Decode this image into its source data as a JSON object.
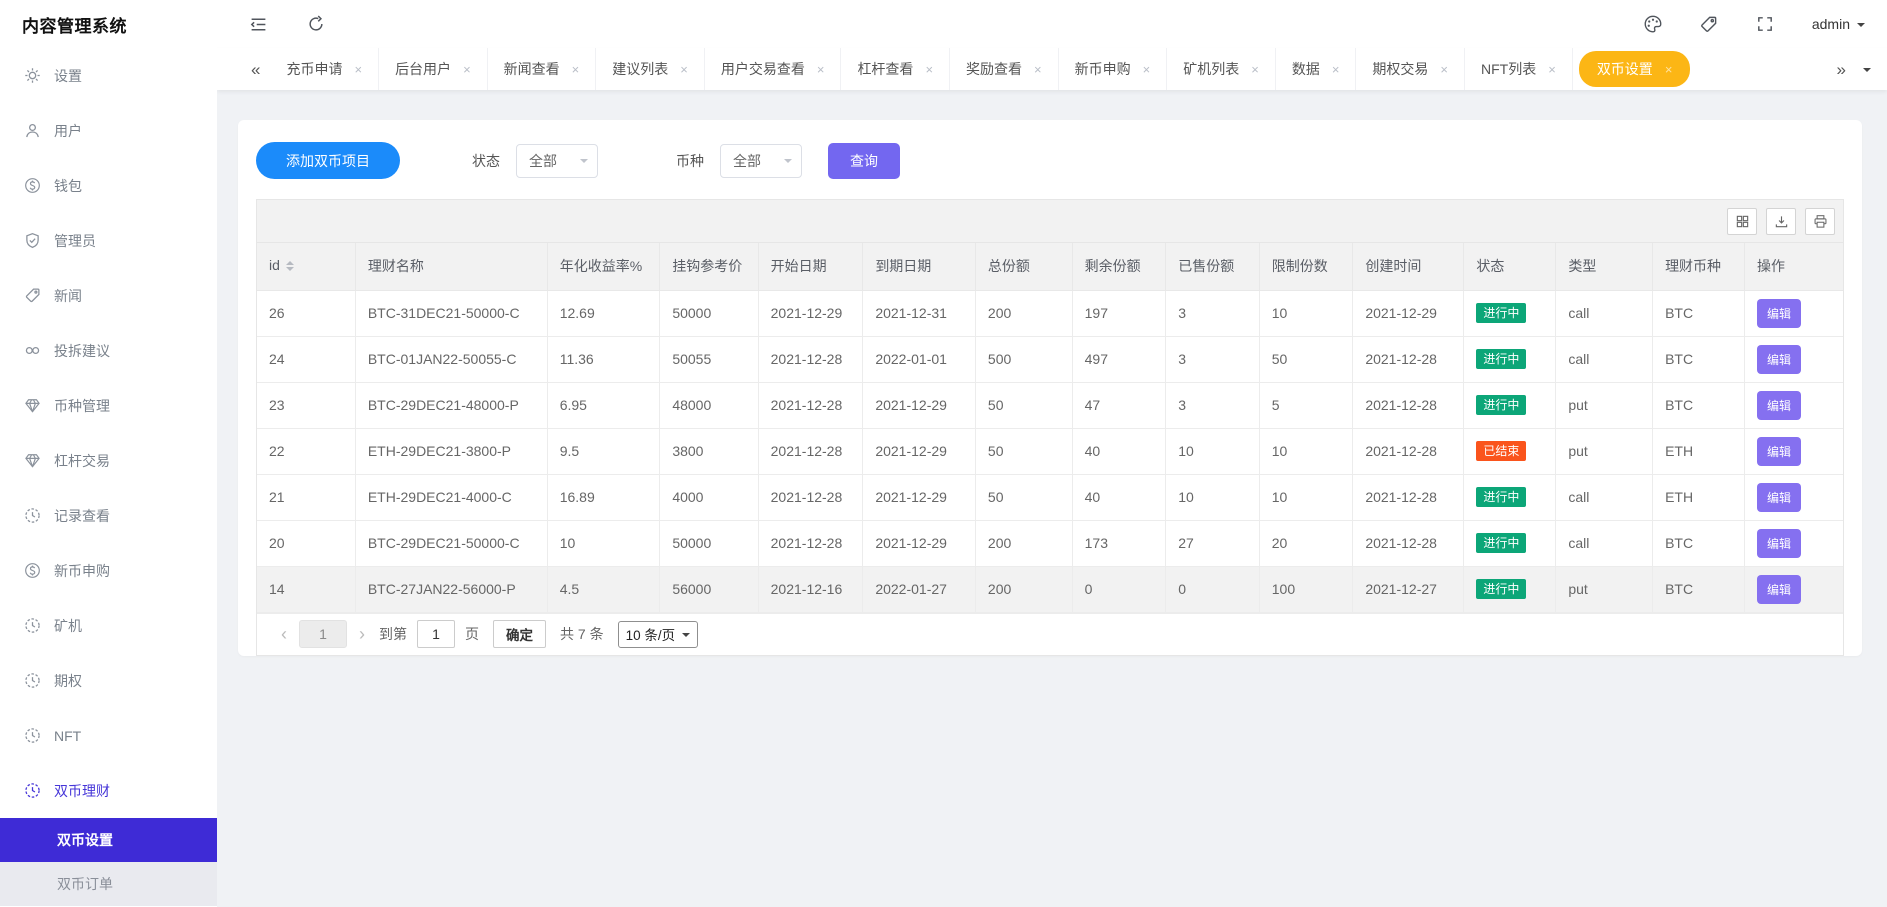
{
  "app": {
    "title": "内容管理系统"
  },
  "topbar": {
    "user": "admin",
    "icons": [
      "menu-fold-icon",
      "refresh-icon",
      "palette-icon",
      "tag-icon",
      "fullscreen-icon",
      "caret-down-icon"
    ]
  },
  "tabbar": {
    "collapse_left": "«",
    "collapse_right": "»",
    "close_glyph": "×",
    "tabs": [
      {
        "label": "充币申请",
        "active": false
      },
      {
        "label": "后台用户",
        "active": false
      },
      {
        "label": "新闻查看",
        "active": false
      },
      {
        "label": "建议列表",
        "active": false
      },
      {
        "label": "用户交易查看",
        "active": false
      },
      {
        "label": "杠杆查看",
        "active": false
      },
      {
        "label": "奖励查看",
        "active": false
      },
      {
        "label": "新币申购",
        "active": false
      },
      {
        "label": "矿机列表",
        "active": false
      },
      {
        "label": "数据",
        "active": false
      },
      {
        "label": "期权交易",
        "active": false
      },
      {
        "label": "NFT列表",
        "active": false
      },
      {
        "label": "双币设置",
        "active": true
      }
    ]
  },
  "sidebar": {
    "items": [
      {
        "icon": "gear-icon",
        "label": "设置"
      },
      {
        "icon": "user-icon",
        "label": "用户"
      },
      {
        "icon": "dollar-circle-icon",
        "label": "钱包"
      },
      {
        "icon": "shield-check-icon",
        "label": "管理员"
      },
      {
        "icon": "tag-icon",
        "label": "新闻"
      },
      {
        "icon": "link-circles-icon",
        "label": "投拆建议"
      },
      {
        "icon": "gem-icon",
        "label": "币种管理"
      },
      {
        "icon": "gem-icon",
        "label": "杠杆交易"
      },
      {
        "icon": "history-icon",
        "label": "记录查看"
      },
      {
        "icon": "dollar-circle-icon",
        "label": "新币申购"
      },
      {
        "icon": "history-icon",
        "label": "矿机"
      },
      {
        "icon": "history-icon",
        "label": "期权"
      },
      {
        "icon": "history-icon",
        "label": "NFT"
      },
      {
        "icon": "history-icon",
        "label": "双币理财",
        "active": true
      }
    ],
    "submenu": [
      {
        "label": "双币设置",
        "active": true
      },
      {
        "label": "双币订单",
        "active": false
      }
    ]
  },
  "filters": {
    "add_button": "添加双币项目",
    "status_label": "状态",
    "status_value": "全部",
    "coin_label": "币种",
    "coin_value": "全部",
    "search_button": "查询"
  },
  "table": {
    "columns": [
      "id",
      "理财名称",
      "年化收益率%",
      "挂钩参考价",
      "开始日期",
      "到期日期",
      "总份额",
      "剩余份额",
      "已售份额",
      "限制份数",
      "创建时间",
      "状态",
      "类型",
      "理财币种",
      "操作"
    ],
    "edit_label": "编辑",
    "rows": [
      {
        "id": "26",
        "name": "BTC-31DEC21-50000-C",
        "rate": "12.69",
        "ref_price": "50000",
        "start": "2021-12-29",
        "end": "2021-12-31",
        "total": "200",
        "remaining": "197",
        "sold": "3",
        "limit": "10",
        "created": "2021-12-29",
        "status": "进行中",
        "status_type": "active",
        "type": "call",
        "coin": "BTC"
      },
      {
        "id": "24",
        "name": "BTC-01JAN22-50055-C",
        "rate": "11.36",
        "ref_price": "50055",
        "start": "2021-12-28",
        "end": "2022-01-01",
        "total": "500",
        "remaining": "497",
        "sold": "3",
        "limit": "50",
        "created": "2021-12-28",
        "status": "进行中",
        "status_type": "active",
        "type": "call",
        "coin": "BTC"
      },
      {
        "id": "23",
        "name": "BTC-29DEC21-48000-P",
        "rate": "6.95",
        "ref_price": "48000",
        "start": "2021-12-28",
        "end": "2021-12-29",
        "total": "50",
        "remaining": "47",
        "sold": "3",
        "limit": "5",
        "created": "2021-12-28",
        "status": "进行中",
        "status_type": "active",
        "type": "put",
        "coin": "BTC"
      },
      {
        "id": "22",
        "name": "ETH-29DEC21-3800-P",
        "rate": "9.5",
        "ref_price": "3800",
        "start": "2021-12-28",
        "end": "2021-12-29",
        "total": "50",
        "remaining": "40",
        "sold": "10",
        "limit": "10",
        "created": "2021-12-28",
        "status": "已结束",
        "status_type": "ended",
        "type": "put",
        "coin": "ETH"
      },
      {
        "id": "21",
        "name": "ETH-29DEC21-4000-C",
        "rate": "16.89",
        "ref_price": "4000",
        "start": "2021-12-28",
        "end": "2021-12-29",
        "total": "50",
        "remaining": "40",
        "sold": "10",
        "limit": "10",
        "created": "2021-12-28",
        "status": "进行中",
        "status_type": "active",
        "type": "call",
        "coin": "ETH"
      },
      {
        "id": "20",
        "name": "BTC-29DEC21-50000-C",
        "rate": "10",
        "ref_price": "50000",
        "start": "2021-12-28",
        "end": "2021-12-29",
        "total": "200",
        "remaining": "173",
        "sold": "27",
        "limit": "20",
        "created": "2021-12-28",
        "status": "进行中",
        "status_type": "active",
        "type": "call",
        "coin": "BTC"
      },
      {
        "id": "14",
        "name": "BTC-27JAN22-56000-P",
        "rate": "4.5",
        "ref_price": "56000",
        "start": "2021-12-16",
        "end": "2022-01-27",
        "total": "200",
        "remaining": "0",
        "sold": "0",
        "limit": "100",
        "created": "2021-12-27",
        "status": "进行中",
        "status_type": "active",
        "type": "put",
        "coin": "BTC",
        "highlighted": true
      }
    ],
    "toolbar_icons": [
      "column-grid-icon",
      "export-icon",
      "print-icon"
    ]
  },
  "pagination": {
    "prev": "‹",
    "page": "1",
    "next": "›",
    "goto_label": "到第",
    "goto_value": "1",
    "page_word": "页",
    "confirm": "确定",
    "total": "共 7 条",
    "per_page": "10 条/页"
  },
  "colors": {
    "primary_blue": "#1b8bfa",
    "search_violet": "#7367f0",
    "active_tab_yellow": "#fcb615",
    "sidebar_active_purple": "#3e2bd6",
    "badge_active_teal": "#0ca678",
    "badge_ended_orange": "#fa541c",
    "edit_violet": "#8570f0",
    "content_bg": "#f0f2f5"
  }
}
